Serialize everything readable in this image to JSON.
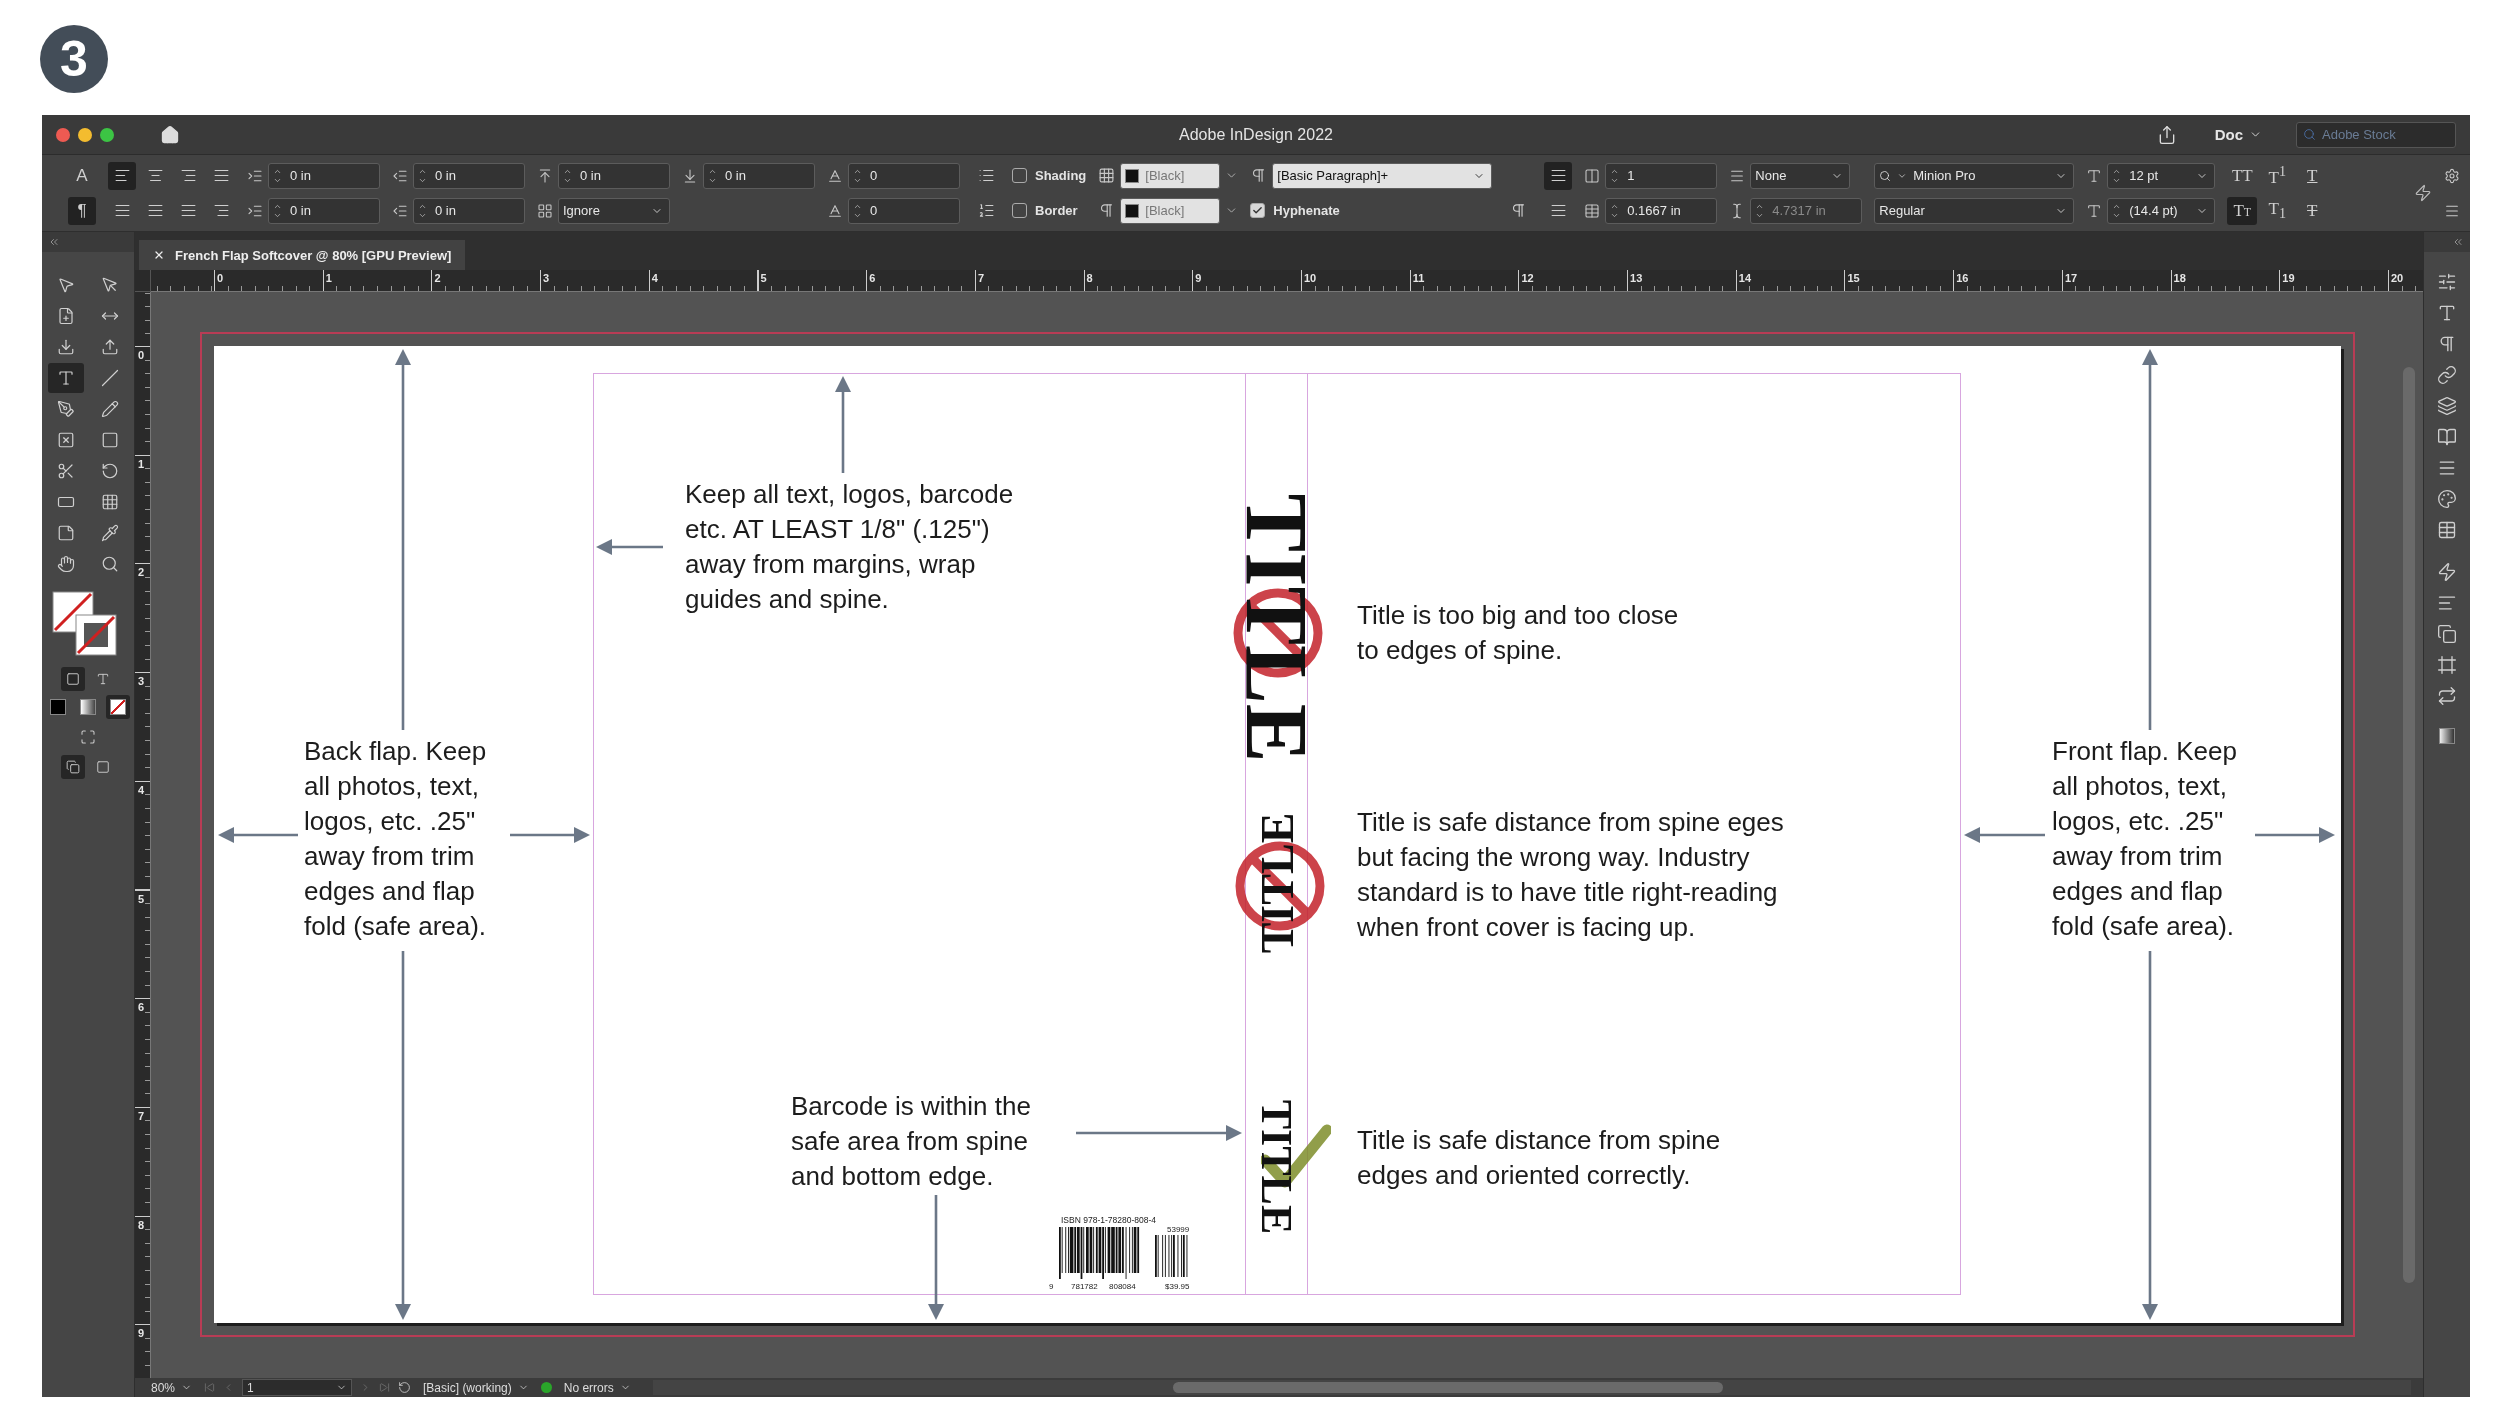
{
  "step_badge": "3",
  "window": {
    "title": "Adobe InDesign 2022"
  },
  "title_bar": {
    "workspace": "Doc",
    "search": {
      "placeholder": "Adobe Stock"
    }
  },
  "control_panel": {
    "columns": [
      {
        "top": {
          "kind": "mode",
          "label": "A",
          "selected": false
        },
        "bottom": {
          "kind": "mode",
          "label": "¶",
          "selected": true
        }
      },
      {
        "top": {
          "kind": "align-group",
          "buttons": [
            {
              "selected": true
            },
            {
              "selected": false
            },
            {
              "selected": false
            },
            {
              "selected": false
            }
          ]
        },
        "bottom": {
          "kind": "align-group",
          "buttons": [
            {
              "selected": false
            },
            {
              "selected": false
            },
            {
              "selected": false
            },
            {
              "selected": false
            }
          ]
        }
      },
      {
        "top": {
          "kind": "spin",
          "value": "0 in",
          "disabled": false
        },
        "bottom": {
          "kind": "spin",
          "value": "0 in",
          "disabled": false
        }
      },
      {
        "top": {
          "kind": "spin",
          "value": "0 in",
          "disabled": false
        },
        "bottom": {
          "kind": "spin",
          "value": "0 in",
          "disabled": false
        }
      },
      {
        "top": {
          "kind": "spin",
          "value": "0 in",
          "disabled": false
        },
        "bottom": {
          "kind": "dropdown",
          "value": "Ignore"
        }
      },
      {
        "top": {
          "kind": "spin",
          "value": "0 in",
          "disabled": false
        }
      },
      {
        "top": {
          "kind": "spin",
          "value": "0",
          "disabled": false
        },
        "bottom": {
          "kind": "spin",
          "value": "0",
          "disabled": false
        }
      },
      {
        "top": {
          "kind": "tool",
          "selected": false
        },
        "bottom": {
          "kind": "tool",
          "selected": false
        }
      },
      {
        "top": {
          "kind": "checkbox",
          "label": "Shading",
          "checked": false
        },
        "bottom": {
          "kind": "checkbox",
          "label": "Border",
          "checked": false
        }
      },
      {
        "top": {
          "kind": "swatch",
          "value": "[Black]"
        },
        "bottom": {
          "kind": "swatch",
          "value": "[Black]"
        }
      },
      {
        "top": {
          "kind": "style",
          "value": "[Basic Paragraph]+"
        },
        "bottom": {
          "kind": "checkbox",
          "label": "Hyphenate",
          "checked": true
        }
      },
      {
        "bottom": {
          "kind": "tool",
          "selected": false
        }
      },
      {
        "top": {
          "kind": "tool",
          "selected": true
        },
        "bottom": {
          "kind": "tool",
          "selected": false
        }
      },
      {
        "top": {
          "kind": "spin",
          "value": "1",
          "disabled": false
        },
        "bottom": {
          "kind": "spin",
          "value": "0.1667 in",
          "disabled": false
        }
      },
      {
        "top": {
          "kind": "dropdown",
          "value": "None"
        },
        "bottom": {
          "kind": "spin",
          "value": "4.7317 in",
          "disabled": true
        }
      },
      {
        "top": {
          "kind": "font",
          "value": "Minion Pro",
          "search": true
        },
        "bottom": {
          "kind": "font",
          "value": "Regular",
          "search": false
        }
      },
      {
        "top": {
          "kind": "spin-combo",
          "value": "12 pt"
        },
        "bottom": {
          "kind": "spin-combo",
          "value": "(14.4 pt)"
        }
      },
      {
        "top": {
          "kind": "type-buttons",
          "buttons": [
            {
              "label": "TT",
              "selected": false
            },
            {
              "label": "T$^{1}$",
              "selected": false
            },
            {
              "label": "T",
              "selected": false
            }
          ]
        },
        "bottom": {
          "kind": "type-buttons",
          "buttons": [
            {
              "label": "Tt",
              "selected": true
            },
            {
              "label": "T$_{1}$",
              "selected": false
            },
            {
              "label": "T",
              "selected": false
            }
          ]
        }
      }
    ]
  },
  "tools": [
    {
      "selected": false
    },
    {
      "selected": false
    },
    {
      "selected": false
    },
    {
      "selected": false
    },
    {
      "selected": false
    },
    {
      "selected": false
    },
    {
      "selected": true
    },
    {
      "selected": false
    },
    {
      "selected": false
    },
    {
      "selected": false
    },
    {
      "selected": false
    },
    {
      "selected": false
    },
    {
      "selected": false
    },
    {
      "selected": false
    },
    {
      "selected": false
    },
    {
      "selected": false
    },
    {
      "selected": false
    },
    {
      "selected": false
    },
    {
      "selected": false
    },
    {
      "selected": false
    }
  ],
  "formatting": [
    {
      "selected": true
    },
    {
      "selected": false
    }
  ],
  "apply": [
    {
      "selected": false
    },
    {
      "selected": false
    },
    {
      "selected": true
    }
  ],
  "view_modes": [
    {
      "selected": true
    },
    {
      "selected": false
    }
  ],
  "tab": {
    "label": "French Flap Softcover @ 80% [GPU Preview]",
    "selected": true
  },
  "horizontal_ruler": [
    "0",
    "1",
    "2",
    "3",
    "4",
    "5",
    "6",
    "7",
    "8",
    "9",
    "10",
    "11",
    "12",
    "13",
    "14",
    "15",
    "16",
    "17",
    "18",
    "19",
    "20"
  ],
  "vertical_ruler": [
    "0",
    "1",
    "2",
    "3",
    "4",
    "5",
    "6",
    "7",
    "8",
    "9"
  ],
  "document": {
    "notes": [
      {
        "lines": [
          "Keep all text, logos, barcode",
          "etc. AT LEAST 1/8\" (.125\")",
          "away from margins, wrap",
          "guides and spine."
        ]
      },
      {
        "lines": [
          "Title is too big and too close",
          "to edges of spine."
        ]
      },
      {
        "lines": [
          "Back flap. Keep",
          "all photos, text,",
          "logos, etc. .25\"",
          "away from trim",
          "edges and flap",
          "fold (safe area)."
        ]
      },
      {
        "lines": [
          "Title is safe distance from spine eges",
          "but facing the wrong way. Industry",
          "standard is to have title right-reading",
          "when front cover is facing up."
        ]
      },
      {
        "lines": [
          "Front flap. Keep",
          "all photos, text,",
          "logos, etc. .25\"",
          "away from trim",
          "edges and flap",
          "fold (safe area)."
        ]
      },
      {
        "lines": [
          "Barcode is within the",
          "safe area from spine",
          "and bottom edge."
        ]
      },
      {
        "lines": [
          "Title is safe distance from spine",
          "edges and oriented correctly."
        ]
      }
    ],
    "spine_titles": [
      {
        "text": "TITLE",
        "reversed": false,
        "kind": "prohibited"
      },
      {
        "text": "TITLE",
        "reversed": true,
        "kind": "prohibited"
      },
      {
        "text": "TITLE",
        "reversed": false,
        "kind": "approved"
      }
    ],
    "barcode": {
      "isbn": "ISBN 978-1-78280-808-4",
      "digits": [
        "9",
        "781782",
        "808084"
      ],
      "addon": "53999",
      "price": "$39.95"
    }
  },
  "status_bar": {
    "zoom": "80%",
    "page": "1",
    "preflight_profile": "[Basic] (working)",
    "preflight_status": {
      "label": "No errors",
      "color": "#2aa52a"
    }
  }
}
